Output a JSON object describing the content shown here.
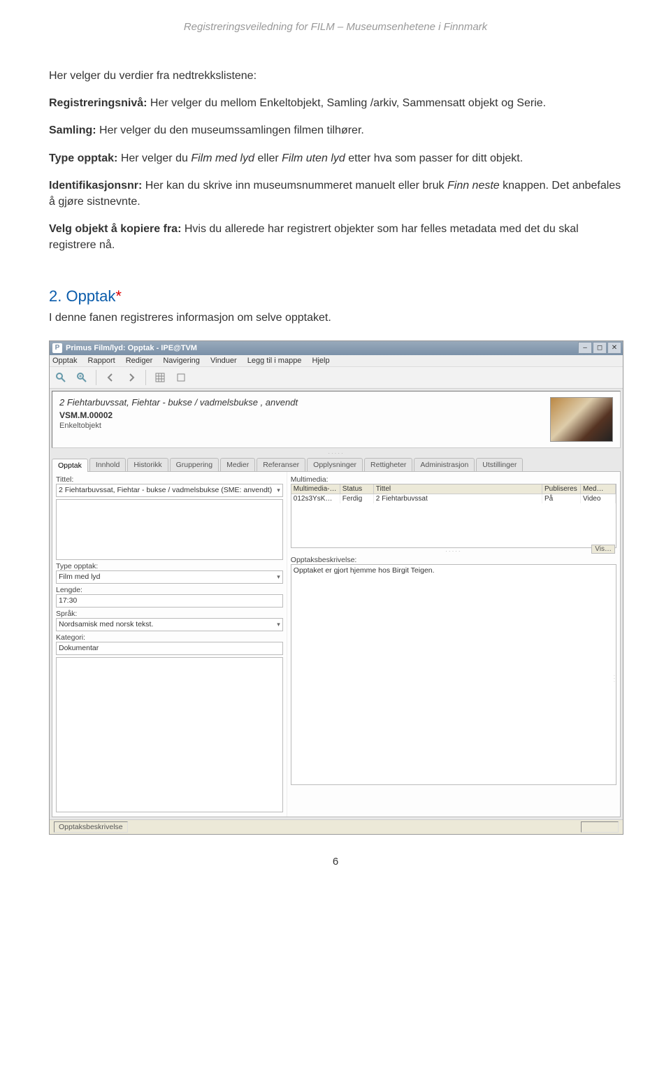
{
  "running_header": "Registreringsveiledning for FILM – Museumsenhetene i Finnmark",
  "intro_line": "Her velger du verdier fra nedtrekkslistene:",
  "para_registreringsniva": {
    "label": "Registreringsnivå:",
    "text": " Her velger du mellom Enkeltobjekt, Samling /arkiv, Sammensatt objekt og Serie."
  },
  "para_samling": {
    "label": "Samling:",
    "text": " Her velger du den museumssamlingen filmen tilhører."
  },
  "para_type_opptak": {
    "label": "Type opptak:",
    "text_a": " Her velger du ",
    "italic_a": "Film med lyd",
    "text_b": " eller ",
    "italic_b": "Film uten lyd",
    "text_c": " etter hva som passer for ditt objekt."
  },
  "para_identifikasjonsnr": {
    "label": "Identifikasjonsnr:",
    "text_a": " Her kan du skrive inn museumsnummeret manuelt eller bruk ",
    "italic_a": "Finn neste",
    "text_b": " knappen. Det anbefales å gjøre sistnevnte."
  },
  "para_velg_objekt": {
    "label": "Velg objekt å kopiere fra:",
    "text": " Hvis du allerede har registrert objekter som har felles metadata med det du skal registrere nå."
  },
  "section2": {
    "number": "2. ",
    "title": "Opptak",
    "asterisk": "*",
    "subtitle": "I denne fanen registreres informasjon om selve opptaket."
  },
  "app": {
    "title": "Primus Film/lyd: Opptak - IPE@TVM",
    "menus": [
      "Opptak",
      "Rapport",
      "Rediger",
      "Navigering",
      "Vinduer",
      "Legg til i mappe",
      "Hjelp"
    ],
    "object": {
      "title": "2 Fiehtarbuvssat, Fiehtar - bukse / vadmelsbukse , anvendt",
      "id": "VSM.M.00002",
      "type": "Enkeltobjekt"
    },
    "tabs": [
      "Opptak",
      "Innhold",
      "Historikk",
      "Gruppering",
      "Medier",
      "Referanser",
      "Opplysninger",
      "Rettigheter",
      "Administrasjon",
      "Utstillinger"
    ],
    "active_tab": "Opptak",
    "left_fields": {
      "tittel_label": "Tittel:",
      "tittel_value": "2 Fiehtarbuvssat, Fiehtar - bukse / vadmelsbukse (SME: anvendt)",
      "type_opptak_label": "Type opptak:",
      "type_opptak_value": "Film med lyd",
      "lengde_label": "Lengde:",
      "lengde_value": "17:30",
      "sprak_label": "Språk:",
      "sprak_value": "Nordsamisk med norsk tekst.",
      "kategori_label": "Kategori:",
      "kategori_value": "Dokumentar"
    },
    "right_fields": {
      "multimedia_label": "Multimedia:",
      "mm_headers": [
        "Multimedia-…",
        "Status",
        "Tittel",
        "Publiseres",
        "Med…"
      ],
      "mm_row": [
        "012s3YsK…",
        "Ferdig",
        "2 Fiehtarbuvssat",
        "På",
        "Video"
      ],
      "opptaksbeskrivelse_label": "Opptaksbeskrivelse:",
      "opptaksbeskrivelse_value": "Opptaket er gjort hjemme hos Birgit Teigen.",
      "vis_btn": "Vis…"
    },
    "statusbar_left": "Opptaksbeskrivelse",
    "statusbar_right": ""
  },
  "page_number": "6"
}
